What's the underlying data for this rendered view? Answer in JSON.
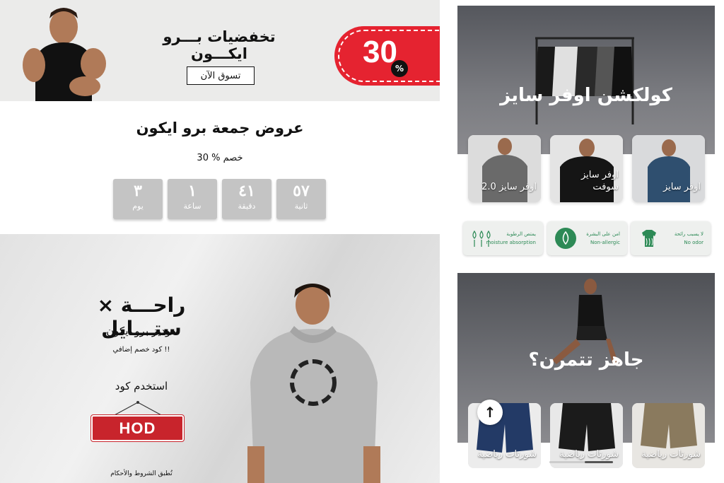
{
  "promo": {
    "title": "تخفضيات بـــرو ايكـــون",
    "shop_label": "تسوق الآن",
    "discount": "30",
    "percent_symbol": "%"
  },
  "black_friday": {
    "title": "عروض جمعة برو ايكون",
    "subtitle": "30 % خصم",
    "countdown": [
      {
        "value": "٥٧",
        "label": "ثانية"
      },
      {
        "value": "٤١",
        "label": "دقيقة"
      },
      {
        "value": "١",
        "label": "ساعة"
      },
      {
        "value": "٣",
        "label": "يوم"
      }
    ]
  },
  "hoodie": {
    "title": "راحـــة × ستـــايل",
    "subtitle": "هوديز برو ايكون",
    "extra": "كود خصم إضافي !!",
    "use_code": "استخدم كود",
    "code": "HOD",
    "terms": "تُطبق الشروط والأحكام"
  },
  "collection": {
    "title": "كولكشن اوفر سايز",
    "cards": [
      {
        "label": "اوفر سايز",
        "color": "#2f4f6f"
      },
      {
        "label": "اوفر سايز سوفت",
        "color": "#151515"
      },
      {
        "label": "اوفر سايز 2.0",
        "color": "#6a6a6a"
      }
    ]
  },
  "features": [
    {
      "ar": "لا يسبب رائحة",
      "en": "No odor"
    },
    {
      "ar": "امن على البشرة",
      "en": "Non-allergic"
    },
    {
      "ar": "يمتص الرطوبة",
      "en": "moisture absorption"
    }
  ],
  "ready": {
    "title": "جاهز تتمرن؟",
    "cards": [
      {
        "label": "شورتات رياضية",
        "color": "#8a7a5e"
      },
      {
        "label": "شورتات رياضية",
        "color": "#1b1b1b"
      },
      {
        "label": "شورتات رياضية",
        "color": "#233a66"
      }
    ]
  },
  "colors": {
    "accent": "#e52330",
    "code_red": "#c8242c",
    "green": "#2d8a56"
  }
}
